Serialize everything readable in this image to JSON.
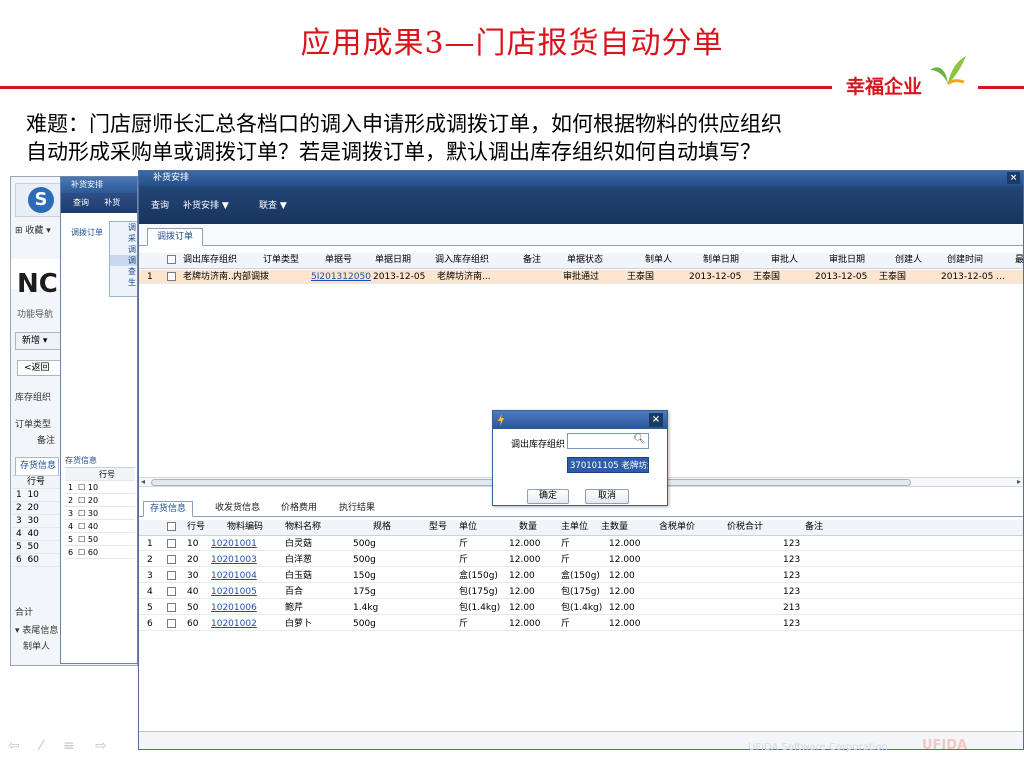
{
  "slide": {
    "title": "应用成果3—门店报货自动分单",
    "brand": "幸福企业",
    "problem_line1": "难题：门店厨师长汇总各档口的调入申请形成调拨订单，如何根据物料的供应组织",
    "problem_line2": "自动形成采购单或调拨订单？若是调拨订单，默认调出库存组织如何自动填写？"
  },
  "colors": {
    "accent_red": "#d8141c",
    "nav_blue": "#234677",
    "highlight_row": "#fde5cf",
    "selected_option": "#2d5da8"
  },
  "bg_app": {
    "favorites": "收藏",
    "nc": "NC",
    "func_nav": "功能导航",
    "new_btn": "新增",
    "back_btn": "返回",
    "inv_org_label": "库存组织",
    "order_type_label": "订单类型",
    "remark_label": "备注",
    "inv_tab": "存货信息",
    "row_no_header": "行号",
    "rows": [
      "10",
      "20",
      "30",
      "40",
      "50",
      "60"
    ],
    "total": "合计",
    "footer_info": "表尾信息",
    "creator": "制单人"
  },
  "mid_window": {
    "title": "补货安排",
    "toolbar_query": "查询",
    "toolbar_replenish": "补货",
    "tab": "调拨订单",
    "menu": [
      "调",
      "采",
      "调",
      "调",
      "查",
      "生"
    ],
    "inv_tab": "存货信息",
    "row_no_header": "行号",
    "rows": [
      "10",
      "20",
      "30",
      "40",
      "50",
      "60"
    ],
    "row_idx": [
      "1",
      "2",
      "3",
      "4",
      "5",
      "6"
    ]
  },
  "main": {
    "title": "补货安排",
    "close": "×",
    "toolbar": {
      "query": "查询",
      "replenish": "补货安排 ▼",
      "linked": "联查 ▼"
    },
    "tab": "调拨订单",
    "columns": [
      "调出库存组织",
      "订单类型",
      "单据号",
      "单据日期",
      "调入库存组织",
      "备注",
      "单据状态",
      "制单人",
      "制单日期",
      "审批人",
      "审批日期",
      "创建人",
      "创建时间",
      "最"
    ],
    "row": {
      "idx": "1",
      "out_org": "老牌坊济南...",
      "order_type": "内部调拨",
      "bill_no": "5I2013120500000",
      "bill_date": "2013-12-05",
      "in_org": "老牌坊济南...",
      "remark": "",
      "status": "审批通过",
      "maker": "王泰国",
      "make_date": "2013-12-05",
      "approver": "王泰国",
      "approve_date": "2013-12-05",
      "creator": "王泰国",
      "create_time": "2013-12-05 ..."
    },
    "lower_tabs": [
      "存货信息",
      "收发货信息",
      "价格费用",
      "执行结果"
    ],
    "detail_columns": [
      "行号",
      "物料编码",
      "物料名称",
      "规格",
      "型号",
      "单位",
      "数量",
      "主单位",
      "主数量",
      "含税单价",
      "价税合计",
      "备注"
    ],
    "detail_rows": [
      {
        "idx": "1",
        "line": "10",
        "code": "10201001",
        "name": "白灵菇",
        "spec": "500g",
        "model": "",
        "unit": "斤",
        "qty": "12.000",
        "main_unit": "斤",
        "main_qty": "12.000",
        "price": "",
        "total": "",
        "remark": "123"
      },
      {
        "idx": "2",
        "line": "20",
        "code": "10201003",
        "name": "白洋葱",
        "spec": "500g",
        "model": "",
        "unit": "斤",
        "qty": "12.000",
        "main_unit": "斤",
        "main_qty": "12.000",
        "price": "",
        "total": "",
        "remark": "123"
      },
      {
        "idx": "3",
        "line": "30",
        "code": "10201004",
        "name": "白玉菇",
        "spec": "150g",
        "model": "",
        "unit": "盒(150g)",
        "qty": "12.00",
        "main_unit": "盒(150g)",
        "main_qty": "12.00",
        "price": "",
        "total": "",
        "remark": "123"
      },
      {
        "idx": "4",
        "line": "40",
        "code": "10201005",
        "name": "百合",
        "spec": "175g",
        "model": "",
        "unit": "包(175g)",
        "qty": "12.00",
        "main_unit": "包(175g)",
        "main_qty": "12.00",
        "price": "",
        "total": "",
        "remark": "123"
      },
      {
        "idx": "5",
        "line": "50",
        "code": "10201006",
        "name": "鲍芹",
        "spec": "1.4kg",
        "model": "",
        "unit": "包(1.4kg)",
        "qty": "12.00",
        "main_unit": "包(1.4kg)",
        "main_qty": "12.00",
        "price": "",
        "total": "",
        "remark": "213"
      },
      {
        "idx": "6",
        "line": "60",
        "code": "10201002",
        "name": "白萝卜",
        "spec": "500g",
        "model": "",
        "unit": "斤",
        "qty": "12.000",
        "main_unit": "斤",
        "main_qty": "12.000",
        "price": "",
        "total": "",
        "remark": "123"
      }
    ]
  },
  "dialog": {
    "close": "×",
    "label": "调出库存组织",
    "input_value": "",
    "option": "370101105 老牌坊济",
    "ok": "确定",
    "cancel": "取消"
  },
  "footer": {
    "nav": "⇦ ⁄ ≡ ⇨",
    "corp": "UFIDA Software Corporation",
    "brand": "UFIDA"
  }
}
